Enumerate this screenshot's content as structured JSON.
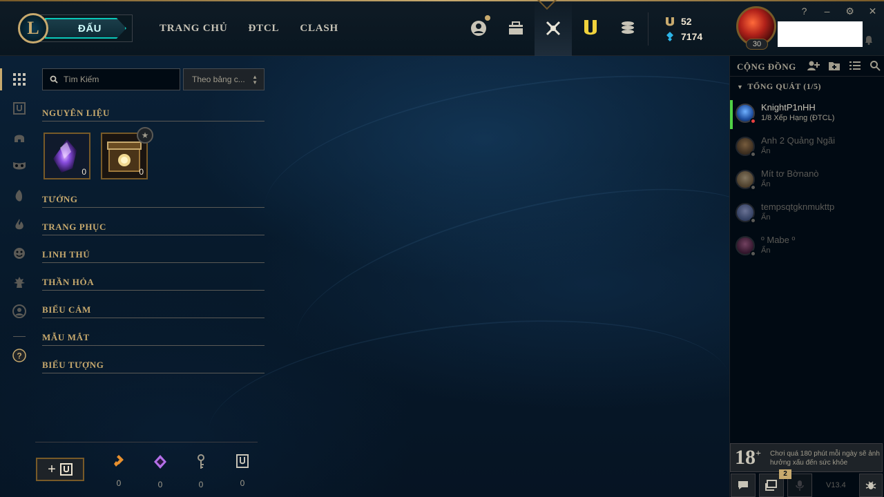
{
  "nav": {
    "play_label": "ĐẤU",
    "links": [
      "TRANG CHỦ",
      "ĐTCL",
      "CLASH"
    ]
  },
  "top_icons": [
    "profile-icon",
    "collection-icon",
    "tft-icon",
    "loot-icon",
    "store-icon"
  ],
  "currency": {
    "blue_essence": "52",
    "riot_points": "7174"
  },
  "profile": {
    "level": "30"
  },
  "window_controls": [
    "?",
    "–",
    "⚙",
    "✕"
  ],
  "loot_panel": {
    "search_placeholder": "Tìm Kiếm",
    "sort_value": "Theo bảng c...",
    "sections": {
      "materials": "NGUYÊN LIỆU",
      "champions": "TƯỚNG",
      "skins": "TRANG PHỤC",
      "companions": "LINH THÚ",
      "wards": "THẦN HỎA",
      "emotes": "BIỂU CẢM",
      "chromas": "MẪU MẮT",
      "icons": "BIỂU TƯỢNG"
    },
    "materials": [
      {
        "name": "orb-icon",
        "count": "0"
      },
      {
        "name": "chest-icon",
        "count": "0"
      }
    ]
  },
  "bottom_currency": [
    {
      "icon": "orange-essence-icon",
      "value": "0",
      "color": "#e8902e"
    },
    {
      "icon": "mythic-essence-icon",
      "value": "0",
      "color": "#b46fe8"
    },
    {
      "icon": "key-icon",
      "value": "0",
      "color": "#a09b8c"
    },
    {
      "icon": "chest-icon",
      "value": "0",
      "color": "#c8c4b7"
    }
  ],
  "social": {
    "title": "CỘNG ĐỒNG",
    "group": "TỔNG QUÁT (1/5)",
    "friends": [
      {
        "name": "KnightP1nHH",
        "status": "1/8 Xếp Hạng (ĐTCL)",
        "online": true
      },
      {
        "name": "Anh 2 Quảng Ngãi",
        "status": "Ẩn",
        "online": false
      },
      {
        "name": "Mít tơ Bờnanò",
        "status": "Ẩn",
        "online": false
      },
      {
        "name": "tempsqtgknmukttp",
        "status": "Ẩn",
        "online": false
      },
      {
        "name": "º Mabe º",
        "status": "Ẩn",
        "online": false
      }
    ],
    "age_rating": "18",
    "age_text": "Chơi quá 180 phút mỗi ngày sẽ ảnh hưởng xấu đến sức khỏe",
    "notification_count": "2",
    "version": "V13.4"
  },
  "colors": {
    "gold": "#c8aa6e",
    "teal": "#0ac8b9",
    "online": "#4fd146",
    "background": "#010a13"
  }
}
